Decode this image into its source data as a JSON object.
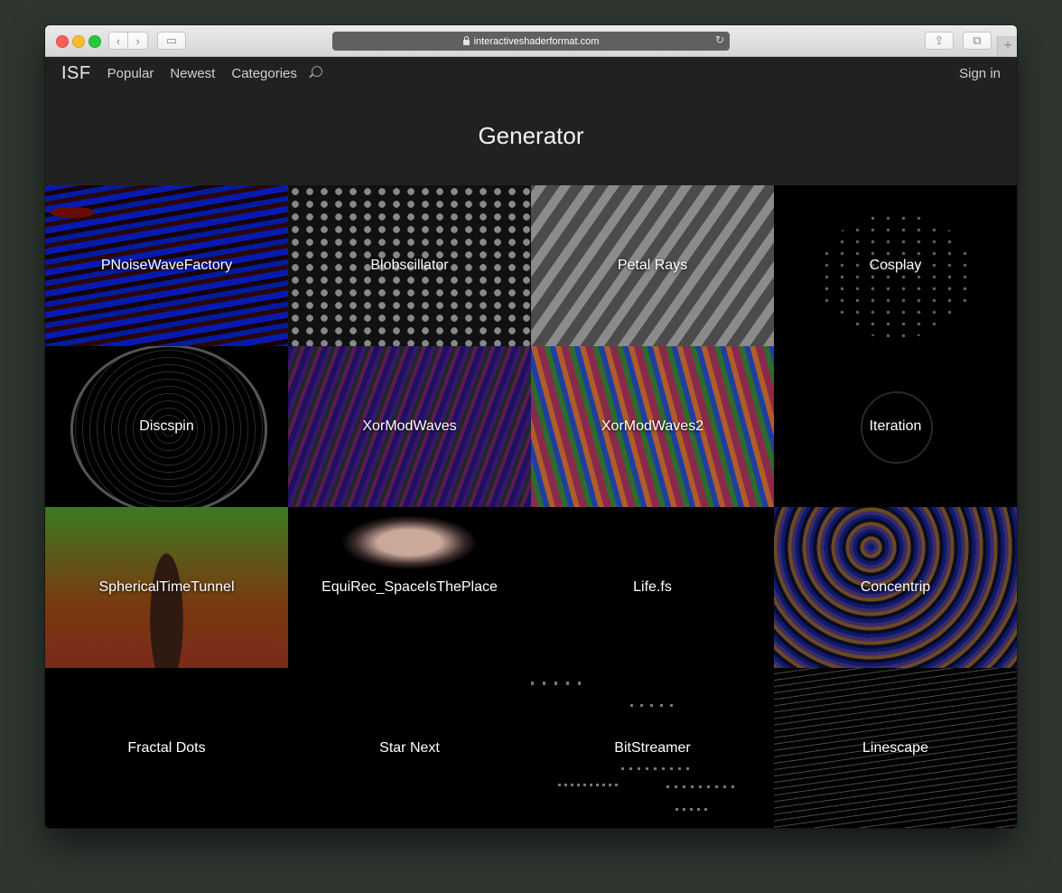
{
  "browser": {
    "url": "interactiveshaderformat.com"
  },
  "nav": {
    "logo": "ISF",
    "items": [
      "Popular",
      "Newest",
      "Categories"
    ],
    "sign_in": "Sign in"
  },
  "page": {
    "title": "Generator"
  },
  "shaders": [
    "PNoiseWaveFactory",
    "Blobscillator",
    "Petal Rays",
    "Cosplay",
    "Discspin",
    "XorModWaves",
    "XorModWaves2",
    "Iteration",
    "SphericalTimeTunnel",
    "EquiRec_SpaceIsThePlace",
    "Life.fs",
    "Concentrip",
    "Fractal Dots",
    "Star Next",
    "BitStreamer",
    "Linescape"
  ]
}
